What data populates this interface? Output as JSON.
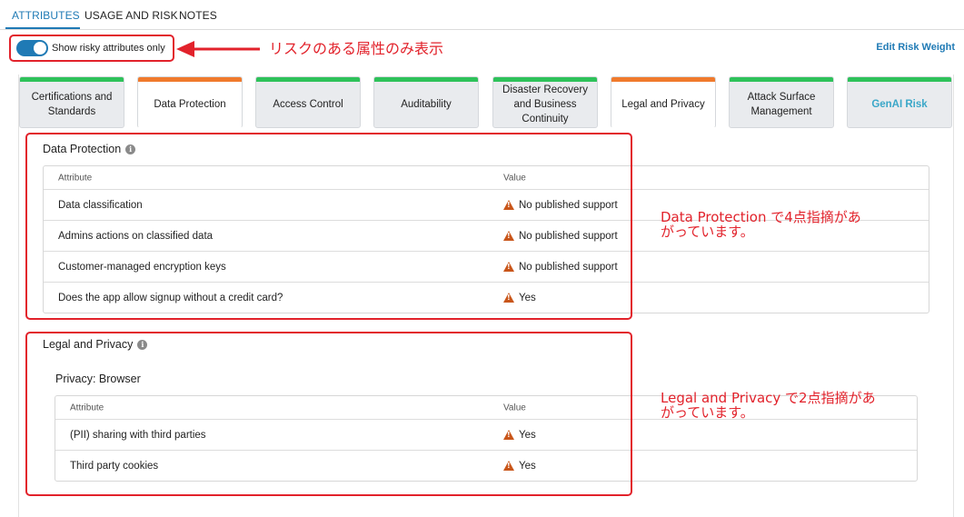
{
  "top_tabs": [
    {
      "label": "ATTRIBUTES",
      "active": true
    },
    {
      "label": "USAGE AND RISK",
      "active": false
    },
    {
      "label": "NOTES",
      "active": false
    }
  ],
  "toggle": {
    "label": "Show risky attributes only",
    "on": true
  },
  "edit_risk_weight": "Edit Risk Weight",
  "categories": [
    {
      "label": "Certifications and Standards",
      "stripe": "#2ec25a",
      "active": false
    },
    {
      "label": "Data Protection",
      "stripe": "#f07a2c",
      "active": true
    },
    {
      "label": "Access Control",
      "stripe": "#2ec25a",
      "active": false
    },
    {
      "label": "Auditability",
      "stripe": "#2ec25a",
      "active": false
    },
    {
      "label": "Disaster Recovery and Business Continuity",
      "stripe": "#2ec25a",
      "active": false
    },
    {
      "label": "Legal and Privacy",
      "stripe": "#f07a2c",
      "active": true
    },
    {
      "label": "Attack Surface Management",
      "stripe": "#2ec25a",
      "active": false
    },
    {
      "label": "GenAI Risk",
      "stripe": "#2ec25a",
      "active": false
    }
  ],
  "data_protection": {
    "title": "Data Protection",
    "headers": {
      "attribute": "Attribute",
      "value": "Value"
    },
    "rows": [
      {
        "attribute": "Data classification",
        "value": "No published support"
      },
      {
        "attribute": "Admins actions on classified data",
        "value": "No published support"
      },
      {
        "attribute": "Customer-managed encryption keys",
        "value": "No published support"
      },
      {
        "attribute": "Does the app allow signup without a credit card?",
        "value": "Yes"
      }
    ]
  },
  "legal_privacy": {
    "title": "Legal and Privacy",
    "subtitle": "Privacy: Browser",
    "headers": {
      "attribute": "Attribute",
      "value": "Value"
    },
    "rows": [
      {
        "attribute": "(PII) sharing with third parties",
        "value": "Yes"
      },
      {
        "attribute": "Third party cookies",
        "value": "Yes"
      }
    ]
  },
  "annotations": {
    "toggle_note": "リスクのある属性のみ表示",
    "data_protection_note_line1": "Data Protection で4点指摘があ",
    "data_protection_note_line2": "がっています。",
    "legal_note_line1": "Legal and Privacy で2点指摘があ",
    "legal_note_line2": "がっています。",
    "color": "#e2222b"
  },
  "colors": {
    "accent": "#1f7ab5",
    "risk_orange": "#f07a2c",
    "ok_green": "#2ec25a",
    "warning": "#c9561a",
    "genai_text": "#3aa7c8"
  }
}
